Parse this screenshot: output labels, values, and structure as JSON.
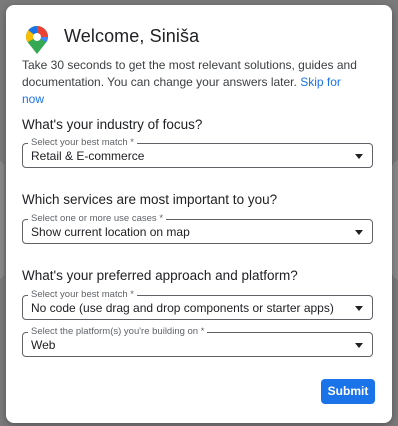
{
  "dialog": {
    "title": "Welcome, Siniša",
    "intro_text": "Take 30 seconds to get the most relevant solutions, guides and documentation. You can change your answers later.",
    "skip_link": "Skip for now",
    "submit_label": "Submit",
    "questions": [
      {
        "question": "What's your industry of focus?",
        "fields": [
          {
            "label": "Select your best match *",
            "value": "Retail & E-commerce"
          }
        ]
      },
      {
        "question": "Which services are most important to you?",
        "fields": [
          {
            "label": "Select one or more use cases *",
            "value": "Show current location on map"
          }
        ]
      },
      {
        "question": "What's your preferred approach and platform?",
        "fields": [
          {
            "label": "Select your best match *",
            "value": "No code (use drag and drop components or starter apps)"
          },
          {
            "label": "Select the platform(s) you're building on *",
            "value": "Web"
          }
        ]
      }
    ]
  },
  "colors": {
    "accent": "#1a73e8",
    "backdrop": "#7a7a7a"
  },
  "icons": {
    "logo": "google-maps-pin-icon",
    "dropdown": "caret-down-icon"
  }
}
